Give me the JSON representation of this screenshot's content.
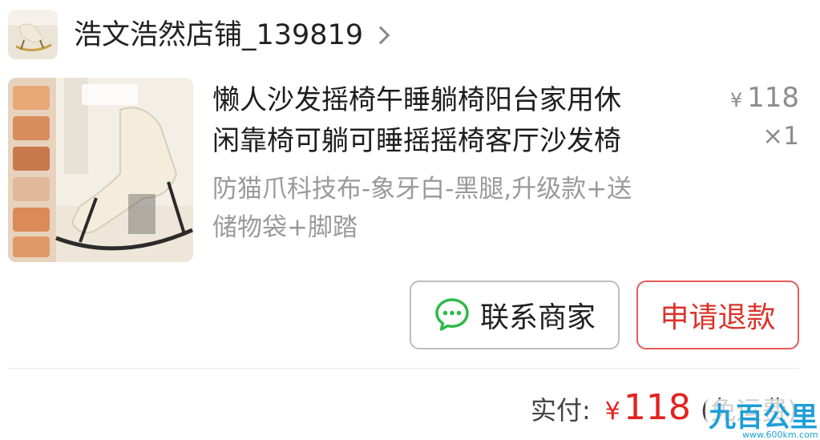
{
  "shop": {
    "name": "浩文浩然店铺_139819",
    "chevron_icon": "chevron-right-icon"
  },
  "product": {
    "image_icon": "rocking-chair-photo",
    "title_line1": "懒人沙发摇椅午睡躺椅阳台家用休",
    "title_line2": "闲靠椅可躺可睡摇摇椅客厅沙发椅",
    "price_symbol": "¥",
    "price": "118",
    "quantity": "×1",
    "spec_line1": "防猫爪科技布-象牙白-黑腿,升级款+送",
    "spec_line2": "储物袋+脚踏"
  },
  "actions": {
    "contact_icon": "wechat-chat-icon",
    "contact_label": "联系商家",
    "refund_label": "申请退款"
  },
  "summary": {
    "paid_label": "实付:",
    "currency": "¥",
    "amount": "118",
    "note": "(免运费)"
  },
  "watermark": {
    "text": "九百公里",
    "url": "www.600km.com"
  },
  "colors": {
    "accent_red": "#e3211e",
    "refund_border": "#e65a5a",
    "muted_text": "#9a9a9a",
    "watermark_blue": "#1e9fd8"
  }
}
